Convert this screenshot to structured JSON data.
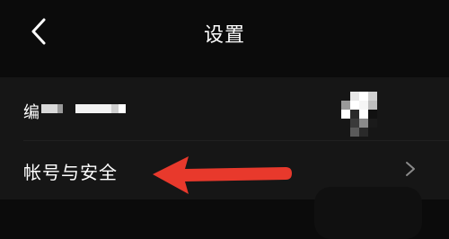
{
  "header": {
    "title": "设置"
  },
  "settings": {
    "rows": [
      {
        "label": "编"
      },
      {
        "label": "帐号与安全"
      }
    ]
  },
  "colors": {
    "background": "#0b0b0b",
    "card": "#161616",
    "annotation_arrow": "#e8392c",
    "text": "#ffffff",
    "chevron": "#8a8a8a"
  },
  "icons": {
    "back": "chevron-left-icon",
    "row_arrow": "chevron-right-icon"
  }
}
